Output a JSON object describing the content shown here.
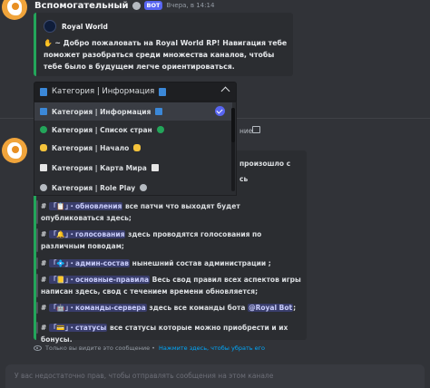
{
  "message1": {
    "author": "Вспомогательный",
    "bot_badge": "BOT",
    "timestamp": "Вчера, в 14:14",
    "embed": {
      "author": "Royal World",
      "description": "✋ ~ Добро пожаловать на Royal World RP! Навигация тебе поможет разобраться среди множества каналов, чтобы тебе было в будущем легче ориентироваться."
    },
    "select": {
      "selected_label": "Категория | Информация",
      "options": [
        {
          "label": "Категория | Информация",
          "selected": true,
          "icon": "book-icon",
          "color": "#3b88d8"
        },
        {
          "label": "Категория | Список стран",
          "selected": false,
          "icon": "green-circle-icon",
          "color": "#23a55a"
        },
        {
          "label": "Категория | Начало",
          "selected": false,
          "icon": "wave-hand-icon",
          "color": "#f5c33b"
        },
        {
          "label": "Категория | Карта Мира",
          "selected": false,
          "icon": "page-icon",
          "color": "#e6e6e6"
        },
        {
          "label": "Категория | Role Play",
          "selected": false,
          "icon": "masks-icon",
          "color": "#b5bac1"
        }
      ]
    }
  },
  "fragments": {
    "behind_menu_1": "ние",
    "behind_menu_2": "произошло с",
    "behind_menu_3": "сь"
  },
  "message2": {
    "channels": [
      {
        "prefix": "#",
        "mention": "「📋」・обновления",
        "text": "все патчи что выходят будет опубликоваться здесь;",
        "icon_color": "#5865f2"
      },
      {
        "prefix": "#",
        "mention": "「🔔」・голосования",
        "text": "здесь проводятся голосования по различным поводам;",
        "icon_color": "#f5c33b"
      },
      {
        "prefix": "#",
        "mention": "「💠」・админ-состав",
        "text": "нынешний состав администрации ;",
        "icon_color": "#3bb5d8"
      },
      {
        "prefix": "#",
        "mention": "「📒」・основные-правила",
        "text": "Весь свод правил всех аспектов игры написан здесь, свод с течением времени обновляется;",
        "icon_color": "#f5c33b"
      },
      {
        "prefix": "#",
        "mention": "「🤖」・команды-сервера",
        "text": "здесь все команды бота",
        "bot_mention": "@Royal Bot",
        "tail": ";",
        "icon_color": "#b5bac1"
      },
      {
        "prefix": "#",
        "mention": "「💳」・статусы",
        "text": "все статусы которые можно приобрести и их бонусы.",
        "icon_color": "#f5c33b"
      }
    ]
  },
  "ephemeral": {
    "text": "Только вы видите это сообщение •",
    "dismiss": "Нажмите здесь, чтобы убрать его"
  },
  "input": {
    "placeholder": "У вас недостаточно прав, чтобы отправлять сообщения на этом канале"
  }
}
